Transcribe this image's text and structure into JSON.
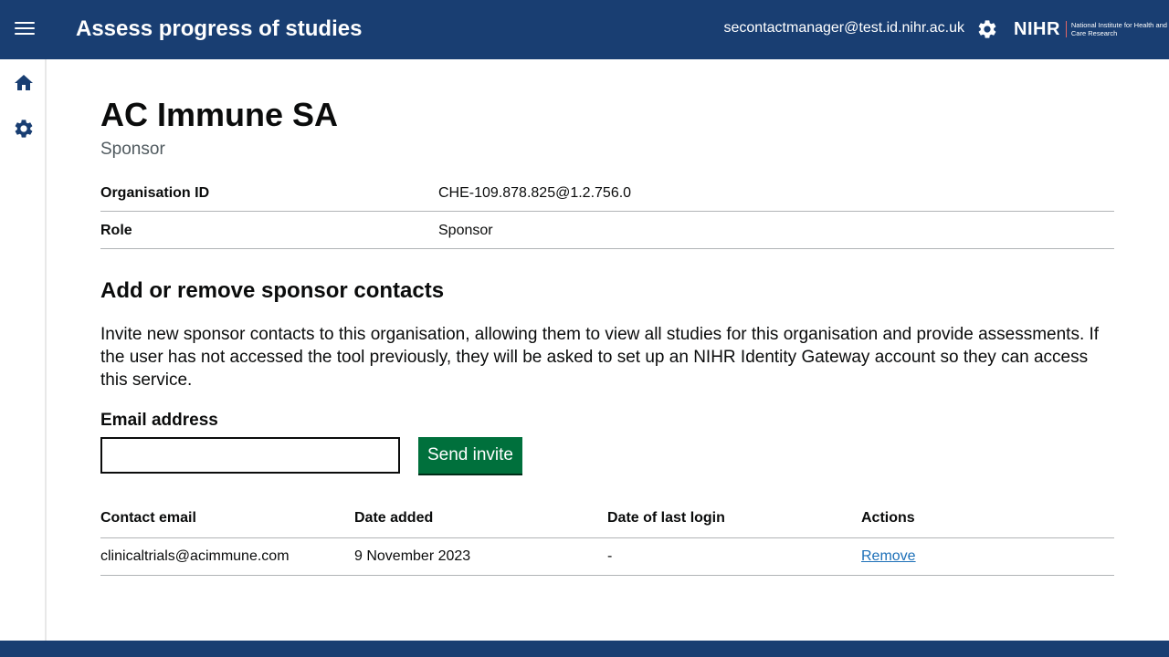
{
  "header": {
    "app_title": "Assess progress of studies",
    "user_email": "secontactmanager@test.id.nihr.ac.uk",
    "logo_mark": "NIHR",
    "logo_subtitle": "National Institute for Health and Care Research",
    "menu_icon": "hamburger-menu-icon",
    "settings_icon": "gear-icon"
  },
  "sidebar": {
    "items": [
      {
        "icon": "home-icon"
      },
      {
        "icon": "gear-icon"
      }
    ]
  },
  "organisation": {
    "name": "AC Immune SA",
    "caption": "Sponsor",
    "summary": [
      {
        "key": "Organisation ID",
        "value": "CHE-109.878.825@1.2.756.0"
      },
      {
        "key": "Role",
        "value": "Sponsor"
      }
    ]
  },
  "contacts_section": {
    "title": "Add or remove sponsor contacts",
    "intro": "Invite new sponsor contacts to this organisation, allowing them to view all studies for this organisation and provide assessments. If the user has not accessed the tool previously, they will be asked to set up an NIHR Identity Gateway account so they can access this service.",
    "email_label": "Email address",
    "email_value": "",
    "send_button": "Send invite",
    "table": {
      "headers": [
        "Contact email",
        "Date added",
        "Date of last login",
        "Actions"
      ],
      "rows": [
        {
          "email": "clinicaltrials@acimmune.com",
          "date_added": "9 November 2023",
          "last_login": "-",
          "action": "Remove"
        }
      ]
    }
  },
  "colors": {
    "header_bg": "#193e72",
    "button_green": "#00703c",
    "link_blue": "#1d70b8"
  }
}
